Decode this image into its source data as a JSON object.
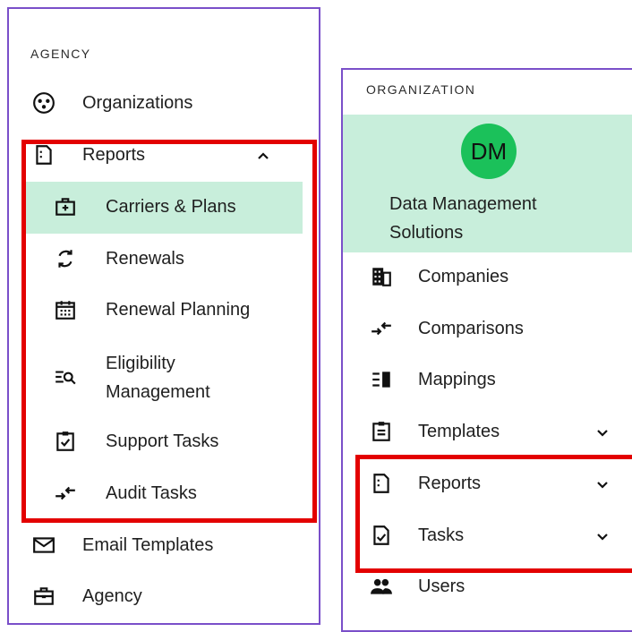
{
  "left_panel": {
    "section_title": "AGENCY",
    "items": [
      {
        "label": "Organizations",
        "icon": "organizations-icon"
      },
      {
        "label": "Reports",
        "icon": "report-icon",
        "expanded": true
      },
      {
        "label": "Carriers & Plans",
        "icon": "carrier-icon",
        "selected": true
      },
      {
        "label": "Renewals",
        "icon": "renew-icon"
      },
      {
        "label": "Renewal Planning",
        "icon": "calendar-icon"
      },
      {
        "label_line1": "Eligibility",
        "label_line2": "Management",
        "icon": "search-list-icon"
      },
      {
        "label": "Support Tasks",
        "icon": "clipboard-check-icon"
      },
      {
        "label": "Audit Tasks",
        "icon": "compare-arrows-icon"
      },
      {
        "label": "Email Templates",
        "icon": "mail-icon"
      },
      {
        "label": "Agency",
        "icon": "briefcase-icon"
      }
    ]
  },
  "right_panel": {
    "section_title": "ORGANIZATION",
    "org": {
      "avatar_initials": "DM",
      "name_line1": "Data Management",
      "name_line2": "Solutions",
      "avatar_color": "#1bc15a"
    },
    "items": [
      {
        "label": "Companies",
        "icon": "building-icon"
      },
      {
        "label": "Comparisons",
        "icon": "compare-arrows-icon"
      },
      {
        "label": "Mappings",
        "icon": "mappings-icon"
      },
      {
        "label": "Templates",
        "icon": "template-icon"
      },
      {
        "label": "Reports",
        "icon": "report-icon"
      },
      {
        "label": "Tasks",
        "icon": "task-icon"
      },
      {
        "label": "Users",
        "icon": "users-icon"
      }
    ]
  },
  "colors": {
    "highlight": "#c8eedb",
    "annotation_red": "#e30000",
    "panel_border": "#7a4fc9"
  }
}
